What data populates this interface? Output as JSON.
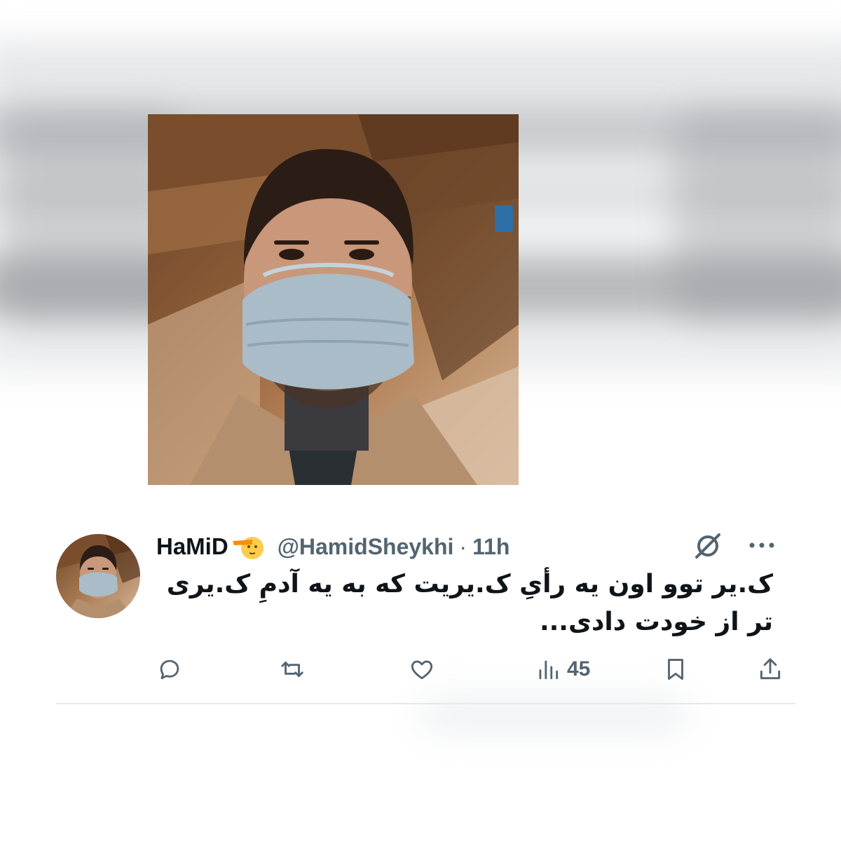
{
  "tweet": {
    "display_name": "HaMiD",
    "emoji_icon": "saluting-face-emoji",
    "handle": "@HamidSheykhi",
    "separator": "·",
    "time": "11h",
    "text": "ک.یر توو اون یه رأیِ ک.یریت که به یه آدمِ ک.یری تر از خودت دادی...",
    "views_count": "45",
    "actions": {
      "reply_icon": "reply-icon",
      "retweet_icon": "retweet-icon",
      "like_icon": "heart-icon",
      "views_icon": "views-icon",
      "bookmark_icon": "bookmark-icon",
      "share_icon": "share-icon"
    }
  },
  "colors": {
    "text_primary": "#0f1419",
    "text_secondary": "#536471",
    "divider": "#e6e9ec"
  }
}
